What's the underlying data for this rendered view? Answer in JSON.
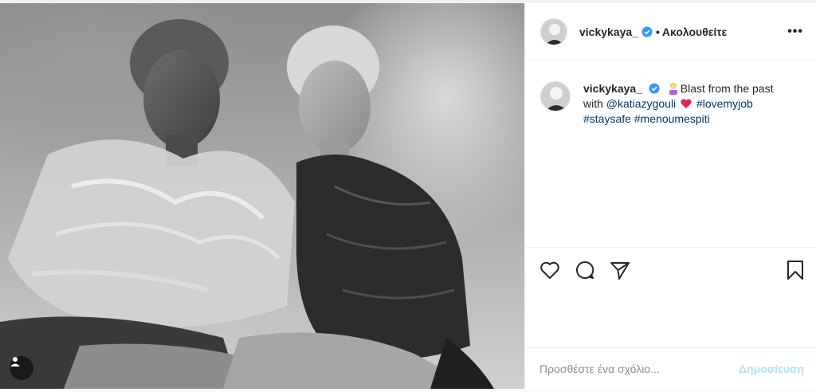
{
  "post": {
    "author": "vickykaya_",
    "separator": "•",
    "follow_status": "Ακολουθείτε",
    "more_label": "•••"
  },
  "caption": {
    "username": "vickykaya_",
    "text_1": "Blast from the past with",
    "mention": "@katiazygouli",
    "hashtags": [
      "#lovemyjob",
      "#staysafe",
      "#menoumespiti"
    ]
  },
  "comment": {
    "placeholder": "Προσθέστε ένα σχόλιο...",
    "post_label": "Δημοσίευση"
  },
  "icons": {
    "verified": "verified-badge-icon",
    "like": "heart-icon",
    "comment": "speech-bubble-icon",
    "share": "paper-plane-icon",
    "save": "bookmark-icon",
    "user_tag": "person-icon"
  },
  "colors": {
    "verified": "#3897f0",
    "link": "#00376b",
    "post_button": "#b2dffc",
    "border": "#efefef"
  }
}
